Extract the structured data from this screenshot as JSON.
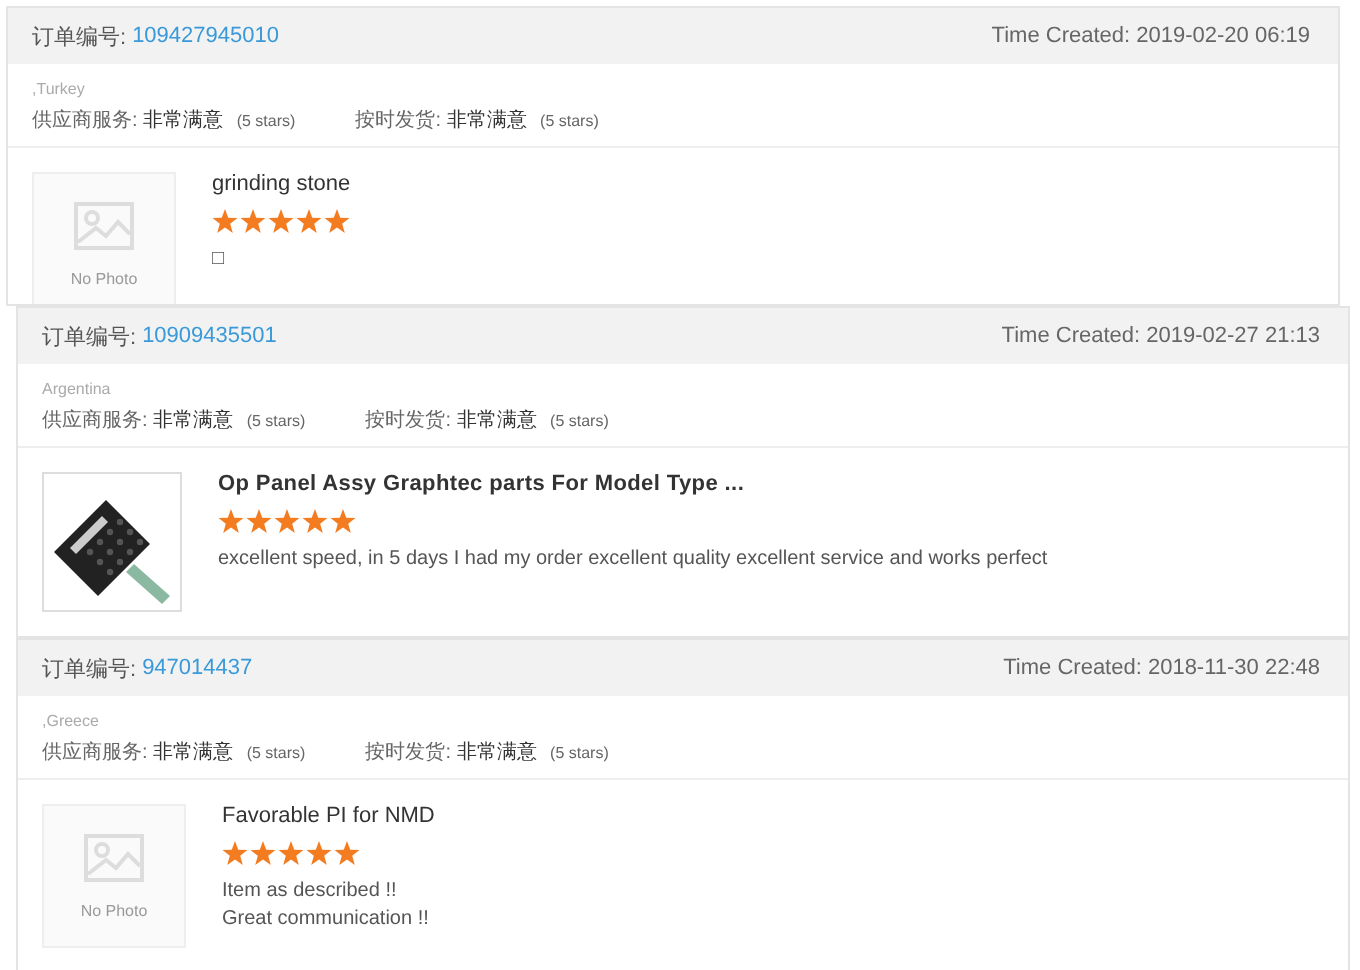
{
  "orders": [
    {
      "order_label": "订单编号:",
      "order_number": "109427945010",
      "time_created": "Time Created: 2019-02-20 06:19",
      "buyer": ",Turkey",
      "ratings": [
        {
          "label": "供应商服务:",
          "value": "非常满意",
          "stars_text": "(5 stars)"
        },
        {
          "label": "按时发货:",
          "value": "非常满意",
          "stars_text": "(5 stars)"
        }
      ],
      "product": {
        "kind": "no_photo",
        "image_text": "No Photo",
        "title": "grinding stone",
        "title_bold": false,
        "stars": 5,
        "review": [
          "□"
        ]
      }
    },
    {
      "order_label": "订单编号:",
      "order_number": "10909435501",
      "time_created": "Time Created: 2019-02-27 21:13",
      "buyer": "Argentina",
      "ratings": [
        {
          "label": "供应商服务:",
          "value": "非常满意",
          "stars_text": "(5 stars)"
        },
        {
          "label": "按时发货:",
          "value": "非常满意",
          "stars_text": "(5 stars)"
        }
      ],
      "product": {
        "kind": "photo",
        "title": "Op Panel Assy Graphtec parts For Model Type ...",
        "title_bold": true,
        "stars": 5,
        "review": [
          "excellent speed, in 5 days I had my order excellent quality excellent service and works perfect"
        ]
      }
    },
    {
      "order_label": "订单编号:",
      "order_number": "947014437",
      "time_created": "Time Created: 2018-11-30 22:48",
      "buyer": ",Greece",
      "ratings": [
        {
          "label": "供应商服务:",
          "value": "非常满意",
          "stars_text": "(5 stars)"
        },
        {
          "label": "按时发货:",
          "value": "非常满意",
          "stars_text": "(5 stars)"
        }
      ],
      "product": {
        "kind": "no_photo",
        "image_text": "No Photo",
        "title": "Favorable PI for NMD",
        "title_bold": false,
        "stars": 5,
        "review": [
          "Item as described !!",
          "Great communication !!"
        ]
      }
    }
  ]
}
